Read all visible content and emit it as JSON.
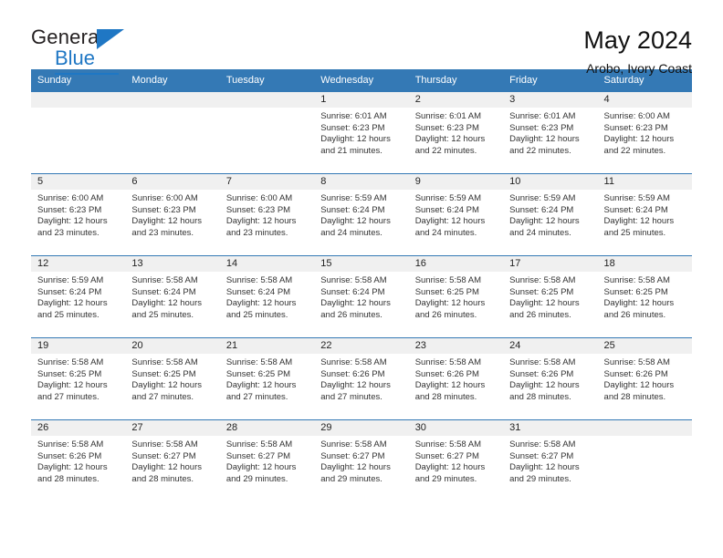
{
  "brand": {
    "word_one": "General",
    "word_two": "Blue",
    "accent_color": "#1f77c4"
  },
  "header": {
    "title": "May 2024",
    "subtitle": "Arobo, Ivory Coast"
  },
  "calendar": {
    "header_bg": "#3479b5",
    "daynum_bg": "#f0f0f0",
    "weekdays": [
      "Sunday",
      "Monday",
      "Tuesday",
      "Wednesday",
      "Thursday",
      "Friday",
      "Saturday"
    ],
    "weeks": [
      [
        {
          "day": "",
          "blank": true,
          "sunrise": "",
          "sunset": "",
          "daylight1": "",
          "daylight2": ""
        },
        {
          "day": "",
          "blank": true,
          "sunrise": "",
          "sunset": "",
          "daylight1": "",
          "daylight2": ""
        },
        {
          "day": "",
          "blank": true,
          "sunrise": "",
          "sunset": "",
          "daylight1": "",
          "daylight2": ""
        },
        {
          "day": "1",
          "sunrise": "Sunrise: 6:01 AM",
          "sunset": "Sunset: 6:23 PM",
          "daylight1": "Daylight: 12 hours",
          "daylight2": "and 21 minutes."
        },
        {
          "day": "2",
          "sunrise": "Sunrise: 6:01 AM",
          "sunset": "Sunset: 6:23 PM",
          "daylight1": "Daylight: 12 hours",
          "daylight2": "and 22 minutes."
        },
        {
          "day": "3",
          "sunrise": "Sunrise: 6:01 AM",
          "sunset": "Sunset: 6:23 PM",
          "daylight1": "Daylight: 12 hours",
          "daylight2": "and 22 minutes."
        },
        {
          "day": "4",
          "sunrise": "Sunrise: 6:00 AM",
          "sunset": "Sunset: 6:23 PM",
          "daylight1": "Daylight: 12 hours",
          "daylight2": "and 22 minutes."
        }
      ],
      [
        {
          "day": "5",
          "sunrise": "Sunrise: 6:00 AM",
          "sunset": "Sunset: 6:23 PM",
          "daylight1": "Daylight: 12 hours",
          "daylight2": "and 23 minutes."
        },
        {
          "day": "6",
          "sunrise": "Sunrise: 6:00 AM",
          "sunset": "Sunset: 6:23 PM",
          "daylight1": "Daylight: 12 hours",
          "daylight2": "and 23 minutes."
        },
        {
          "day": "7",
          "sunrise": "Sunrise: 6:00 AM",
          "sunset": "Sunset: 6:23 PM",
          "daylight1": "Daylight: 12 hours",
          "daylight2": "and 23 minutes."
        },
        {
          "day": "8",
          "sunrise": "Sunrise: 5:59 AM",
          "sunset": "Sunset: 6:24 PM",
          "daylight1": "Daylight: 12 hours",
          "daylight2": "and 24 minutes."
        },
        {
          "day": "9",
          "sunrise": "Sunrise: 5:59 AM",
          "sunset": "Sunset: 6:24 PM",
          "daylight1": "Daylight: 12 hours",
          "daylight2": "and 24 minutes."
        },
        {
          "day": "10",
          "sunrise": "Sunrise: 5:59 AM",
          "sunset": "Sunset: 6:24 PM",
          "daylight1": "Daylight: 12 hours",
          "daylight2": "and 24 minutes."
        },
        {
          "day": "11",
          "sunrise": "Sunrise: 5:59 AM",
          "sunset": "Sunset: 6:24 PM",
          "daylight1": "Daylight: 12 hours",
          "daylight2": "and 25 minutes."
        }
      ],
      [
        {
          "day": "12",
          "sunrise": "Sunrise: 5:59 AM",
          "sunset": "Sunset: 6:24 PM",
          "daylight1": "Daylight: 12 hours",
          "daylight2": "and 25 minutes."
        },
        {
          "day": "13",
          "sunrise": "Sunrise: 5:58 AM",
          "sunset": "Sunset: 6:24 PM",
          "daylight1": "Daylight: 12 hours",
          "daylight2": "and 25 minutes."
        },
        {
          "day": "14",
          "sunrise": "Sunrise: 5:58 AM",
          "sunset": "Sunset: 6:24 PM",
          "daylight1": "Daylight: 12 hours",
          "daylight2": "and 25 minutes."
        },
        {
          "day": "15",
          "sunrise": "Sunrise: 5:58 AM",
          "sunset": "Sunset: 6:24 PM",
          "daylight1": "Daylight: 12 hours",
          "daylight2": "and 26 minutes."
        },
        {
          "day": "16",
          "sunrise": "Sunrise: 5:58 AM",
          "sunset": "Sunset: 6:25 PM",
          "daylight1": "Daylight: 12 hours",
          "daylight2": "and 26 minutes."
        },
        {
          "day": "17",
          "sunrise": "Sunrise: 5:58 AM",
          "sunset": "Sunset: 6:25 PM",
          "daylight1": "Daylight: 12 hours",
          "daylight2": "and 26 minutes."
        },
        {
          "day": "18",
          "sunrise": "Sunrise: 5:58 AM",
          "sunset": "Sunset: 6:25 PM",
          "daylight1": "Daylight: 12 hours",
          "daylight2": "and 26 minutes."
        }
      ],
      [
        {
          "day": "19",
          "sunrise": "Sunrise: 5:58 AM",
          "sunset": "Sunset: 6:25 PM",
          "daylight1": "Daylight: 12 hours",
          "daylight2": "and 27 minutes."
        },
        {
          "day": "20",
          "sunrise": "Sunrise: 5:58 AM",
          "sunset": "Sunset: 6:25 PM",
          "daylight1": "Daylight: 12 hours",
          "daylight2": "and 27 minutes."
        },
        {
          "day": "21",
          "sunrise": "Sunrise: 5:58 AM",
          "sunset": "Sunset: 6:25 PM",
          "daylight1": "Daylight: 12 hours",
          "daylight2": "and 27 minutes."
        },
        {
          "day": "22",
          "sunrise": "Sunrise: 5:58 AM",
          "sunset": "Sunset: 6:26 PM",
          "daylight1": "Daylight: 12 hours",
          "daylight2": "and 27 minutes."
        },
        {
          "day": "23",
          "sunrise": "Sunrise: 5:58 AM",
          "sunset": "Sunset: 6:26 PM",
          "daylight1": "Daylight: 12 hours",
          "daylight2": "and 28 minutes."
        },
        {
          "day": "24",
          "sunrise": "Sunrise: 5:58 AM",
          "sunset": "Sunset: 6:26 PM",
          "daylight1": "Daylight: 12 hours",
          "daylight2": "and 28 minutes."
        },
        {
          "day": "25",
          "sunrise": "Sunrise: 5:58 AM",
          "sunset": "Sunset: 6:26 PM",
          "daylight1": "Daylight: 12 hours",
          "daylight2": "and 28 minutes."
        }
      ],
      [
        {
          "day": "26",
          "sunrise": "Sunrise: 5:58 AM",
          "sunset": "Sunset: 6:26 PM",
          "daylight1": "Daylight: 12 hours",
          "daylight2": "and 28 minutes."
        },
        {
          "day": "27",
          "sunrise": "Sunrise: 5:58 AM",
          "sunset": "Sunset: 6:27 PM",
          "daylight1": "Daylight: 12 hours",
          "daylight2": "and 28 minutes."
        },
        {
          "day": "28",
          "sunrise": "Sunrise: 5:58 AM",
          "sunset": "Sunset: 6:27 PM",
          "daylight1": "Daylight: 12 hours",
          "daylight2": "and 29 minutes."
        },
        {
          "day": "29",
          "sunrise": "Sunrise: 5:58 AM",
          "sunset": "Sunset: 6:27 PM",
          "daylight1": "Daylight: 12 hours",
          "daylight2": "and 29 minutes."
        },
        {
          "day": "30",
          "sunrise": "Sunrise: 5:58 AM",
          "sunset": "Sunset: 6:27 PM",
          "daylight1": "Daylight: 12 hours",
          "daylight2": "and 29 minutes."
        },
        {
          "day": "31",
          "sunrise": "Sunrise: 5:58 AM",
          "sunset": "Sunset: 6:27 PM",
          "daylight1": "Daylight: 12 hours",
          "daylight2": "and 29 minutes."
        },
        {
          "day": "",
          "blank": true,
          "sunrise": "",
          "sunset": "",
          "daylight1": "",
          "daylight2": ""
        }
      ]
    ]
  }
}
